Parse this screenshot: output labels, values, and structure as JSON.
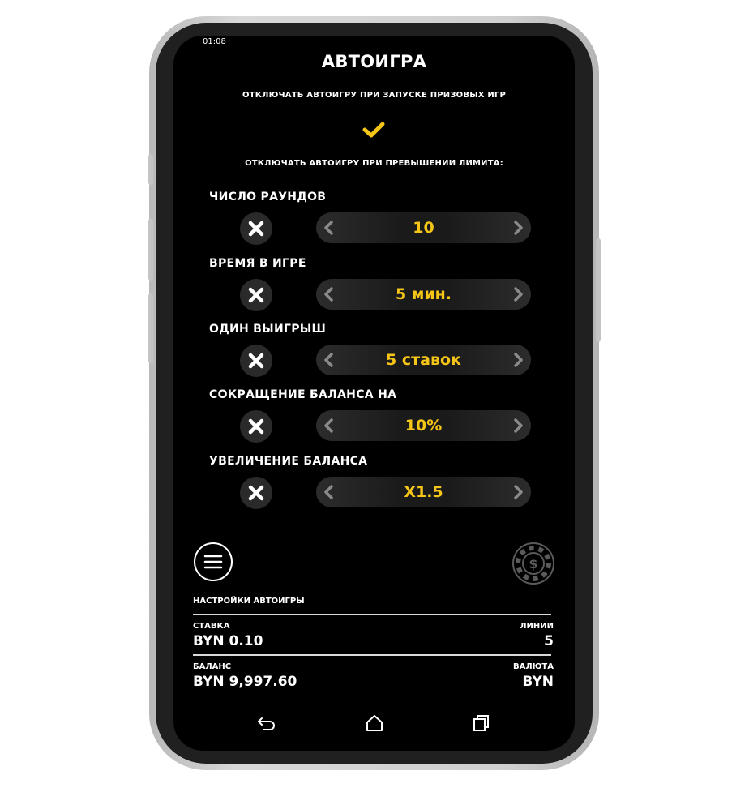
{
  "status_bar": {
    "time": "01:08"
  },
  "header": {
    "title": "АВТОИГРА"
  },
  "prize_games": {
    "label": "ОТКЛЮЧАТЬ АВТОИГРУ ПРИ ЗАПУСКЕ ПРИЗОВЫХ ИГР",
    "checked": true
  },
  "limits_heading": "ОТКЛЮЧАТЬ АВТОИГРУ ПРИ ПРЕВЫШЕНИИ ЛИМИТА:",
  "options": [
    {
      "label": "ЧИСЛО РАУНДОВ",
      "value": "10"
    },
    {
      "label": "ВРЕМЯ В ИГРЕ",
      "value": "5 мин."
    },
    {
      "label": "ОДИН ВЫИГРЫШ",
      "value": "5 ставок"
    },
    {
      "label": "СОКРАЩЕНИЕ БАЛАНСА НА",
      "value": "10%"
    },
    {
      "label": "УВЕЛИЧЕНИЕ БАЛАНСА",
      "value": "X1.5"
    }
  ],
  "info": {
    "title": "НАСТРОЙКИ АВТОИГРЫ",
    "bet_label": "СТАВКА",
    "bet_value": "BYN 0.10",
    "lines_label": "ЛИНИИ",
    "lines_value": "5",
    "balance_label": "БАЛАНС",
    "balance_value": "BYN 9,997.60",
    "currency_label": "ВАЛЮТА",
    "currency_value": "BYN"
  },
  "icons": {
    "menu": "hamburger-menu-icon",
    "chip": "dollar-chip-icon",
    "close": "x-icon",
    "check": "checkmark-icon",
    "back": "back-icon",
    "home": "home-icon",
    "recents": "recents-icon"
  },
  "colors": {
    "accent": "#f5c518",
    "background": "#000000",
    "text": "#ffffff"
  }
}
